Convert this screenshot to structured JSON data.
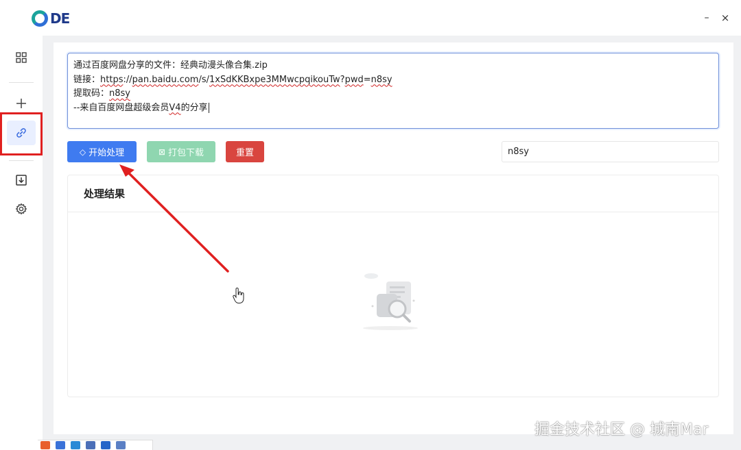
{
  "app": {
    "logo_text": "DE"
  },
  "window_controls": {
    "minimize": "–",
    "close": "×"
  },
  "sidebar": {
    "items": [
      {
        "name": "dashboard",
        "icon": "grid-icon"
      },
      {
        "name": "add",
        "icon": "plus-icon"
      },
      {
        "name": "link",
        "icon": "link-icon",
        "active": true
      },
      {
        "name": "download",
        "icon": "download-icon"
      },
      {
        "name": "settings",
        "icon": "gear-icon"
      }
    ]
  },
  "share_input": {
    "line1": "通过百度网盘分享的文件：经典动漫头像合集.zip",
    "line2_prefix": "链接：",
    "line2_a": "https",
    "line2_b": "://",
    "line2_c": "pan.baidu.com",
    "line2_d": "/s/",
    "line2_e": "1xSdKKBxpe3MMwcpqikouTw",
    "line2_f": "?",
    "line2_g": "pwd",
    "line2_h": "=",
    "line2_i": "n8sy",
    "line3_prefix": "提取码：",
    "line3_code": "n8sy",
    "line4_a": "--来自百度网盘超级会员",
    "line4_b": "V4",
    "line4_c": "的分享"
  },
  "toolbar": {
    "start_label": "开始处理",
    "pack_label": "打包下载",
    "reset_label": "重置",
    "code_value": "n8sy"
  },
  "result": {
    "title": "处理结果"
  },
  "watermark": "掘金技术社区 @ 城南Mar",
  "colors": {
    "primary": "#3f7bf0",
    "pack": "#8fd6b0",
    "reset": "#d9453f",
    "annotation": "#e02020"
  }
}
